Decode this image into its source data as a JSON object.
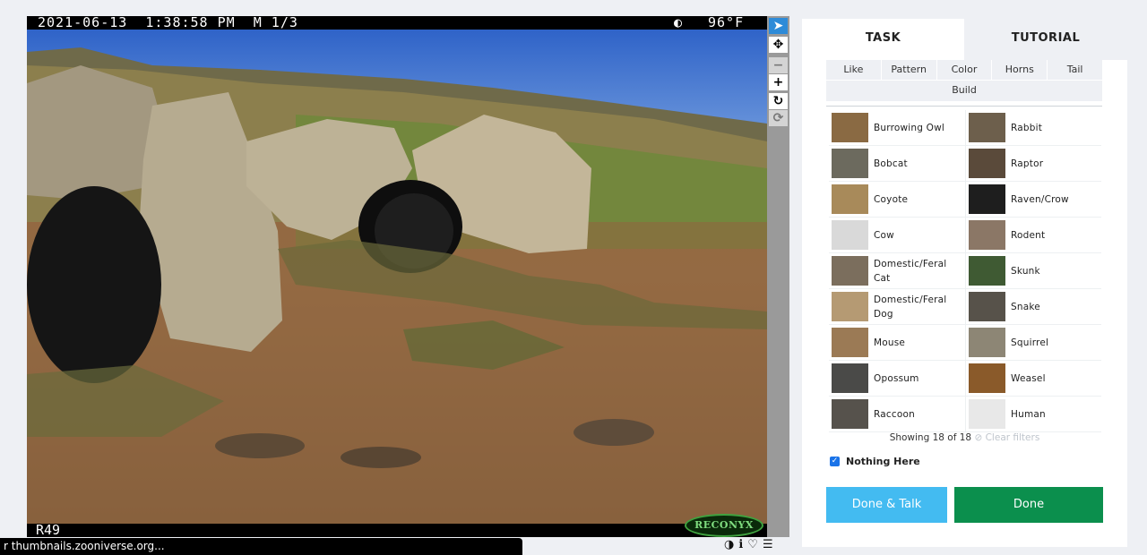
{
  "camera": {
    "timestamp": "2021-06-13  1:38:58 PM  M 1/3",
    "moon": "◐",
    "temperature": "96°F",
    "camera_id": "R49",
    "brand": "RECONYX"
  },
  "toolbar": {
    "tools": [
      {
        "name": "select-tool",
        "glyph": "➤"
      },
      {
        "name": "move-tool",
        "glyph": "✥"
      },
      {
        "name": "zoom-out-tool",
        "glyph": "−"
      },
      {
        "name": "zoom-in-tool",
        "glyph": "+"
      },
      {
        "name": "rotate-tool",
        "glyph": "↻"
      },
      {
        "name": "reset-tool",
        "glyph": "⟳"
      }
    ]
  },
  "status_url": "r thumbnails.zooniverse.org...",
  "meta_icons": [
    "◑",
    "ℹ",
    "♡",
    "☰"
  ],
  "tabs": {
    "task": "TASK",
    "tutorial": "TUTORIAL"
  },
  "filters": [
    "Like",
    "Pattern",
    "Color",
    "Horns",
    "Tail",
    "Build"
  ],
  "choices": [
    {
      "label": "Burrowing Owl",
      "color": "#8a6a43"
    },
    {
      "label": "Rabbit",
      "color": "#6d5f4c"
    },
    {
      "label": "Bobcat",
      "color": "#6c6a5e"
    },
    {
      "label": "Raptor",
      "color": "#5a4a3a"
    },
    {
      "label": "Coyote",
      "color": "#a88a5a"
    },
    {
      "label": "Raven/Crow",
      "color": "#1e1e1e"
    },
    {
      "label": "Cow",
      "color": "#d9d9d9"
    },
    {
      "label": "Rodent",
      "color": "#8b7766"
    },
    {
      "label": "Domestic/Feral Cat",
      "color": "#7b6e5d"
    },
    {
      "label": "Skunk",
      "color": "#3f5a33"
    },
    {
      "label": "Domestic/Feral Dog",
      "color": "#b59a73"
    },
    {
      "label": "Snake",
      "color": "#57524a"
    },
    {
      "label": "Mouse",
      "color": "#9b7a55"
    },
    {
      "label": "Squirrel",
      "color": "#8d8675"
    },
    {
      "label": "Opossum",
      "color": "#4a4a48"
    },
    {
      "label": "Weasel",
      "color": "#8a5a2a"
    },
    {
      "label": "Raccoon",
      "color": "#56524c"
    },
    {
      "label": "Human",
      "color": "#e8e8e8"
    }
  ],
  "showing": "Showing 18 of 18",
  "clear_filters": "⊘ Clear filters",
  "nothing_here": "Nothing Here",
  "buttons": {
    "done_talk": "Done & Talk",
    "done": "Done"
  }
}
